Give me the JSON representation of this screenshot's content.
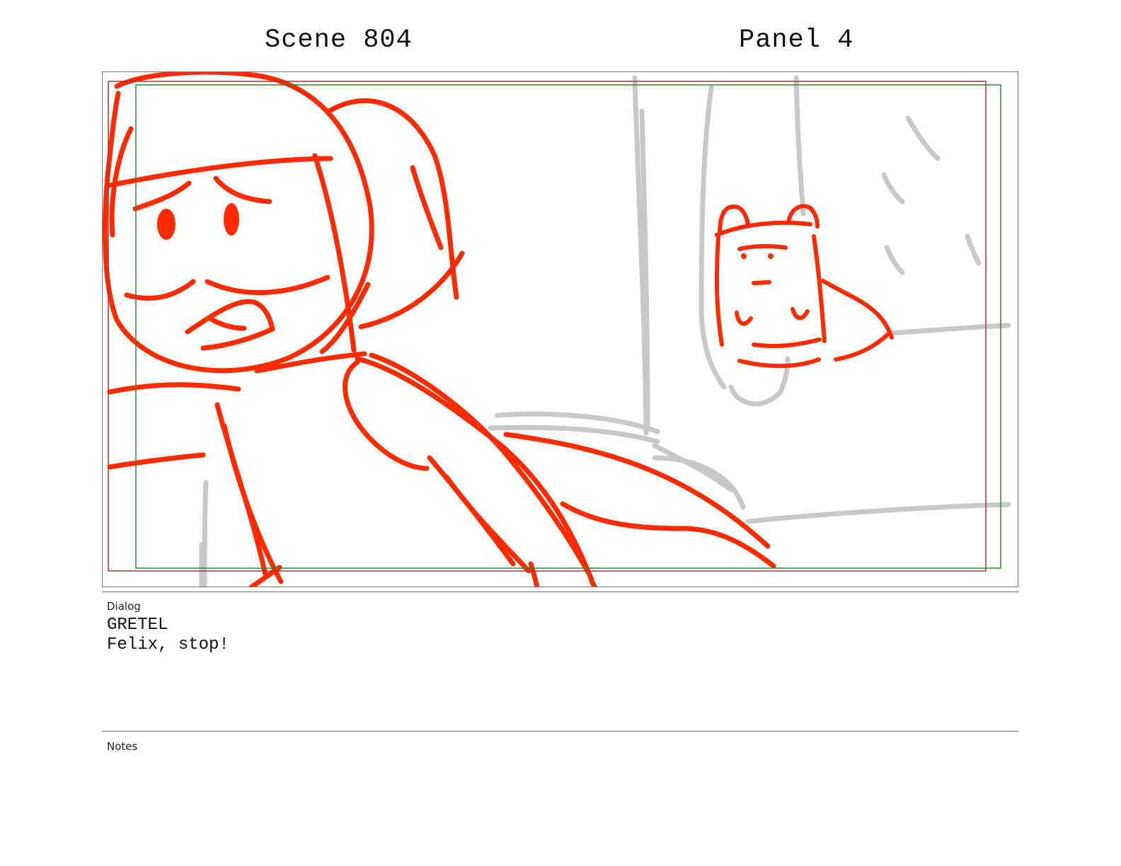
{
  "header": {
    "scene": "Scene 804",
    "panel": "Panel 4"
  },
  "sections": {
    "dialog_label": "Dialog",
    "notes_label": "Notes"
  },
  "dialog": {
    "character": "GRETEL",
    "line": "Felix, stop!"
  },
  "notes": {
    "text": ""
  },
  "colors": {
    "sketch_red": "#ff2a00",
    "sketch_gray": "#c8c8c8",
    "safe_frame_red": "#b03030",
    "safe_frame_green": "#2f8a2f"
  }
}
